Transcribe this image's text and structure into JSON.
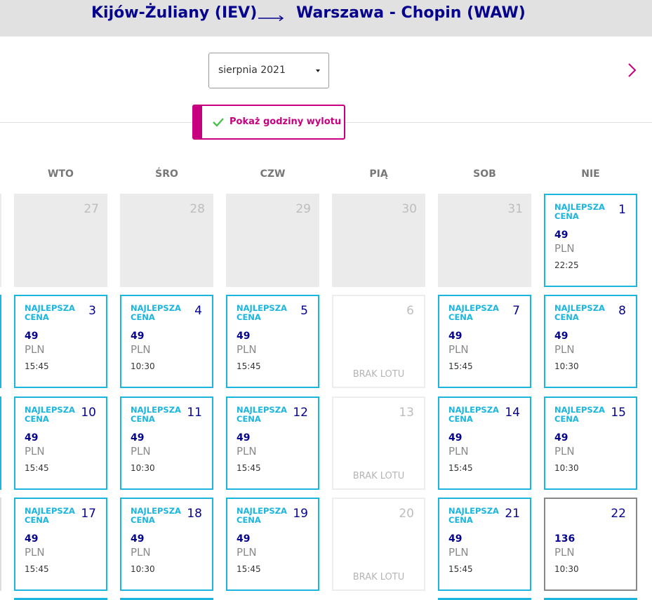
{
  "header": {
    "from": "Kijów-Żuliany (IEV)",
    "to": "Warszawa - Chopin (WAW)"
  },
  "controls": {
    "month": "sierpnia 2021",
    "toggle_label": "Pokaż godziny wylotu"
  },
  "weekdays": [
    "WTO",
    "ŚRO",
    "CZW",
    "PIĄ",
    "SOB",
    "NIE"
  ],
  "labels": {
    "best_price": "NAJLEPSZA CENA",
    "currency": "PLN",
    "no_flight": "BRAK LOTU"
  },
  "rows": [
    [
      {
        "day": "27",
        "state": "empty"
      },
      {
        "day": "28",
        "state": "empty"
      },
      {
        "day": "29",
        "state": "empty"
      },
      {
        "day": "30",
        "state": "empty"
      },
      {
        "day": "31",
        "state": "empty"
      },
      {
        "day": "1",
        "state": "flight",
        "price": "49",
        "time": "22:25"
      }
    ],
    [
      {
        "day": "3",
        "state": "flight",
        "price": "49",
        "time": "15:45"
      },
      {
        "day": "4",
        "state": "flight",
        "price": "49",
        "time": "10:30"
      },
      {
        "day": "5",
        "state": "flight",
        "price": "49",
        "time": "15:45"
      },
      {
        "day": "6",
        "state": "noflight"
      },
      {
        "day": "7",
        "state": "flight",
        "price": "49",
        "time": "15:45"
      },
      {
        "day": "8",
        "state": "flight",
        "price": "49",
        "time": "10:30"
      }
    ],
    [
      {
        "day": "10",
        "state": "flight",
        "price": "49",
        "time": "15:45"
      },
      {
        "day": "11",
        "state": "flight",
        "price": "49",
        "time": "10:30"
      },
      {
        "day": "12",
        "state": "flight",
        "price": "49",
        "time": "15:45"
      },
      {
        "day": "13",
        "state": "noflight"
      },
      {
        "day": "14",
        "state": "flight",
        "price": "49",
        "time": "15:45"
      },
      {
        "day": "15",
        "state": "flight",
        "price": "49",
        "time": "10:30"
      }
    ],
    [
      {
        "day": "17",
        "state": "flight",
        "price": "49",
        "time": "15:45"
      },
      {
        "day": "18",
        "state": "flight",
        "price": "49",
        "time": "10:30"
      },
      {
        "day": "19",
        "state": "flight",
        "price": "49",
        "time": "15:45"
      },
      {
        "day": "20",
        "state": "noflight"
      },
      {
        "day": "21",
        "state": "flight",
        "price": "49",
        "time": "15:45"
      },
      {
        "day": "22",
        "state": "selected",
        "price": "136",
        "time": "10:30"
      }
    ]
  ],
  "colors": {
    "brand_blue": "#06038d",
    "accent_magenta": "#c6007e",
    "cell_border": "#1bb5dd"
  }
}
